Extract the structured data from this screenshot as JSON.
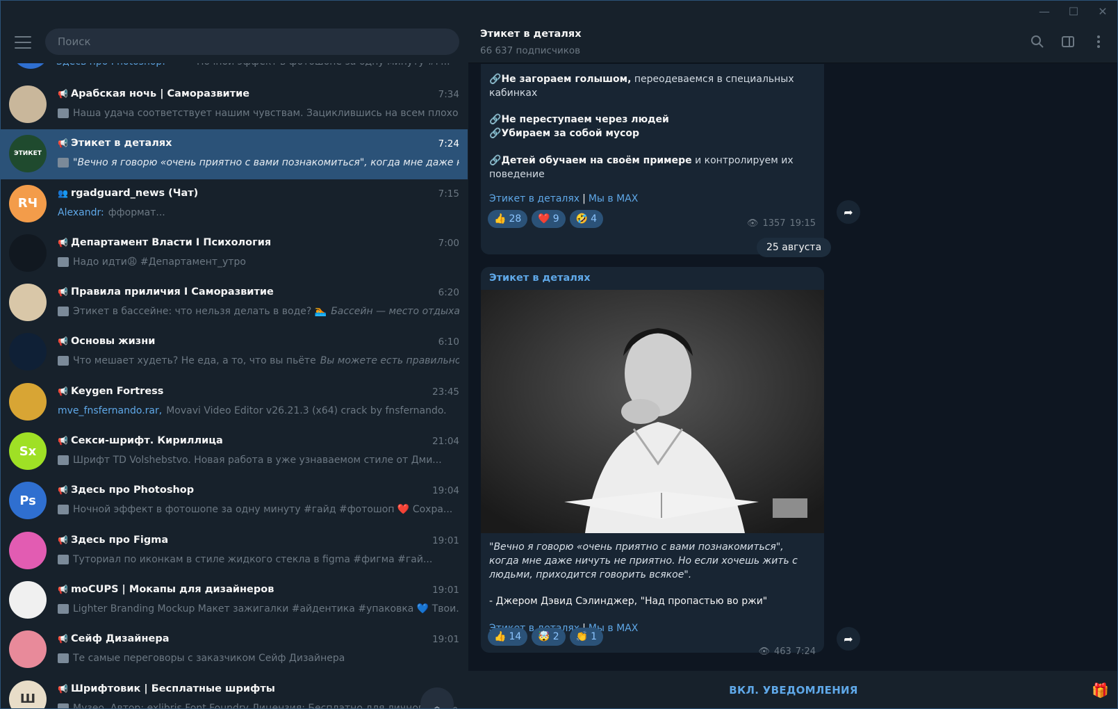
{
  "window": {
    "minimize": "—",
    "maximize": "☐",
    "close": "✕"
  },
  "search": {
    "placeholder": "Поиск"
  },
  "peek": {
    "text": "Здесь про Photoshop:",
    "preview": "Ночной эффект в фотошопе за одну минуту #г..."
  },
  "chats": [
    {
      "title": "Арабская ночь | Саморазвитие",
      "time": "7:34",
      "preview": "Наша удача соответствует нашим чувствам. Зациклившись на всем плохо...",
      "color": "#c9b79b",
      "initials": ""
    },
    {
      "title": "Этикет в деталях",
      "time": "7:24",
      "preview": "\"Вечно я говорю «очень приятно с вами познакомиться\", когда мне даже нич...",
      "color": "#1f4a2e",
      "initials": "ЭТИКЕТ",
      "active": true
    },
    {
      "title": "rgadguard_news (Чат)",
      "time": "7:15",
      "sender": "Alexandr:",
      "preview": "фформат...",
      "color": "#f39c4a",
      "initials": "RЧ"
    },
    {
      "title": "Департамент Власти I Психология",
      "time": "7:00",
      "preview": "Надо идти😩 #Департамент_утро",
      "color": "#111820",
      "initials": ""
    },
    {
      "title": "Правила приличия I Саморазвитие",
      "time": "6:20",
      "preview": "Этикет в бассейне: что нельзя делать в воде? 🏊",
      "preview_italic": "Бассейн — место отдыха ...",
      "color": "#d9c7a8",
      "initials": ""
    },
    {
      "title": "Основы жизни",
      "time": "6:10",
      "preview": "Что мешает худеть? Не еда, а то, что вы пьёте",
      "preview_italic": "Вы можете есть правильно, ...",
      "color": "#0f2036",
      "initials": ""
    },
    {
      "title": "Keygen Fortress",
      "time": "23:45",
      "file": "mve_fnsfernando.rar,",
      "preview": "Movavi Video Editor v26.21.3 (x64) crack by fnsfernando.",
      "color": "#d8a534",
      "initials": ""
    },
    {
      "title": "Секси-шрифт. Кириллица",
      "time": "21:04",
      "preview": "Шрифт TD Volshebstvo. Новая работа в уже узнаваемом стиле от Дми...",
      "color": "#9fe025",
      "initials": "Sx"
    },
    {
      "title": "Здесь про Photoshop",
      "time": "19:04",
      "preview": "Ночной эффект в фотошопе за одну минуту #гайд #фотошоп  ❤️ Сохра...",
      "color": "#2f6fd0",
      "initials": "Ps"
    },
    {
      "title": "Здесь про Figma",
      "time": "19:01",
      "preview": "Туториал по иконкам в стиле жидкого стекла в figma #фигма #гай...",
      "color": "#e25cb2",
      "initials": ""
    },
    {
      "title": "moCUPS | Мокапы для дизайнеров",
      "time": "19:01",
      "preview": "Lighter Branding Mockup  Макет зажигалки  #айдентика #упаковка  💙 Твои...",
      "color": "#f0f0f0",
      "initials": ""
    },
    {
      "title": "Сейф Дизайнера",
      "time": "19:01",
      "preview": "Те самые переговоры с заказчиком  Сейф Дизайнера",
      "color": "#e88a9a",
      "initials": ""
    },
    {
      "title": "Шрифтовик | Бесплатные шрифты",
      "time": "",
      "preview": "Музео. Автор: exlibris Font Foundry Лицензия: Бесплатно для личного...",
      "color": "#e8ddc8",
      "initials": "Ш"
    }
  ],
  "scroll_counter": "0",
  "header": {
    "title": "Этикет в деталях",
    "subtitle": "66 637 подписчиков"
  },
  "message1": {
    "line1_bold": "Не загораем голышом,",
    "line1_rest": " переодеваемся в специальных кабинках",
    "line2_bold": "Не переступаем через людей",
    "line3_bold": "Убираем за собой мусор",
    "line4_bold": "Детей обучаем на своём примере",
    "line4_rest": " и контролируем их поведение",
    "link1": "Этикет в деталях",
    "sep": "|",
    "link2": "Мы в MAX",
    "reactions": [
      {
        "emoji": "👍",
        "count": "28"
      },
      {
        "emoji": "❤️",
        "count": "9"
      },
      {
        "emoji": "🤣",
        "count": "4"
      }
    ],
    "views": "1357",
    "time": "19:15"
  },
  "date_separator": "25 августа",
  "message2": {
    "author": "Этикет в деталях",
    "quote": "\"Вечно я говорю «очень приятно с вами познакомиться\", когда мне даже ничуть не приятно. Но если хочешь жить с людьми, приходится говорить всякое\".",
    "attribution": "- Джером Дэвид Сэлинджер, \"Над пропастью во ржи\"",
    "link1": "Этикет в деталях",
    "sep": "|",
    "link2": "Мы в MAX",
    "reactions": [
      {
        "emoji": "👍",
        "count": "14"
      },
      {
        "emoji": "🤯",
        "count": "2"
      },
      {
        "emoji": "👏",
        "count": "1"
      }
    ],
    "views": "463",
    "time": "7:24"
  },
  "bottom": {
    "notify": "ВКЛ. УВЕДОМЛЕНИЯ"
  },
  "colors": {
    "accent": "#5fa8e8",
    "active": "#2b5278",
    "panel": "#17212b",
    "bg": "#0e1621"
  }
}
